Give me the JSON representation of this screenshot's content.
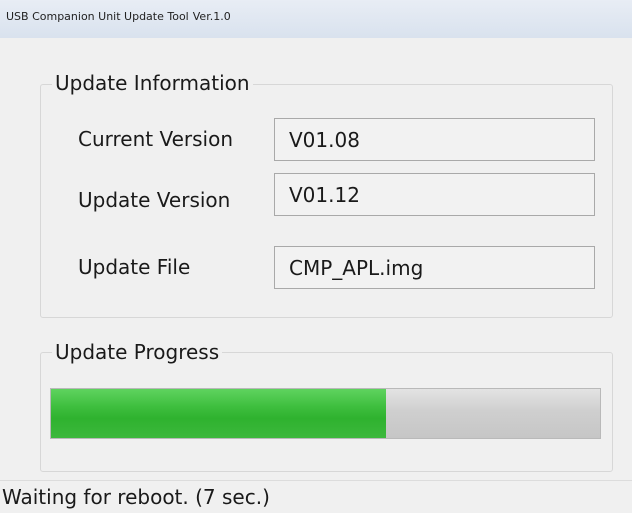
{
  "window": {
    "title": "USB Companion Unit Update Tool",
    "version": "Ver.1.0"
  },
  "update_info": {
    "group_label": "Update Information",
    "current_version_label": "Current Version",
    "current_version_value": "V01.08",
    "update_version_label": "Update Version",
    "update_version_value": "V01.12",
    "update_file_label": "Update File",
    "update_file_value": "CMP_APL.img"
  },
  "progress": {
    "group_label": "Update Progress",
    "fraction": 0.61,
    "fill_color": "#3cb83c"
  },
  "status": {
    "text": "Waiting for reboot. (7 sec.)"
  }
}
